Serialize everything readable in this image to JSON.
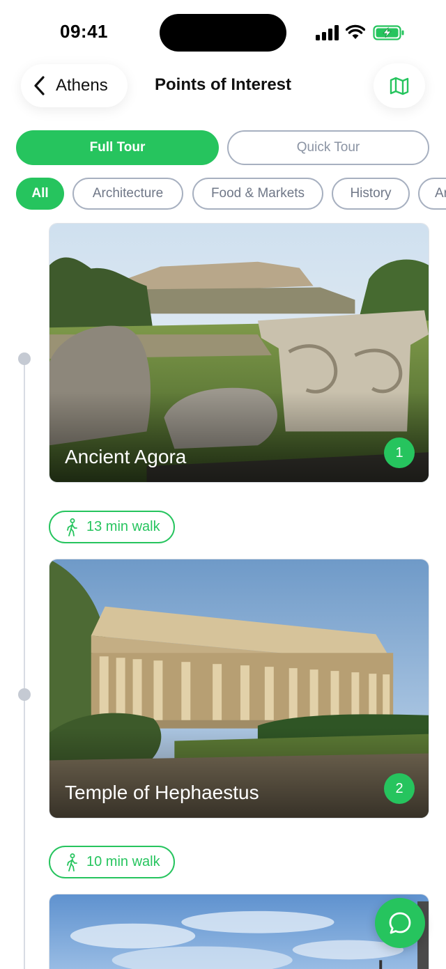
{
  "status_bar": {
    "time": "09:41"
  },
  "header": {
    "back_label": "Athens",
    "title": "Points of Interest"
  },
  "tour_toggle": {
    "full_label": "Full Tour",
    "quick_label": "Quick Tour",
    "selected": "Full Tour"
  },
  "chips": [
    {
      "label": "All",
      "active": true
    },
    {
      "label": "Architecture",
      "active": false
    },
    {
      "label": "Food & Markets",
      "active": false
    },
    {
      "label": "History",
      "active": false
    },
    {
      "label": "Ar",
      "active": false
    }
  ],
  "places": [
    {
      "name": "Ancient Agora",
      "number": "1"
    },
    {
      "name": "Temple of Hephaestus",
      "number": "2"
    }
  ],
  "walks": [
    {
      "label": "13 min walk"
    },
    {
      "label": "10 min walk"
    }
  ],
  "colors": {
    "accent": "#26c45e",
    "outline": "#a7b0c0",
    "chip_text": "#6f7787"
  },
  "icons": [
    "chevron-left-icon",
    "map-icon",
    "walk-icon",
    "chat-icon",
    "signal-icon",
    "wifi-icon",
    "battery-icon"
  ]
}
